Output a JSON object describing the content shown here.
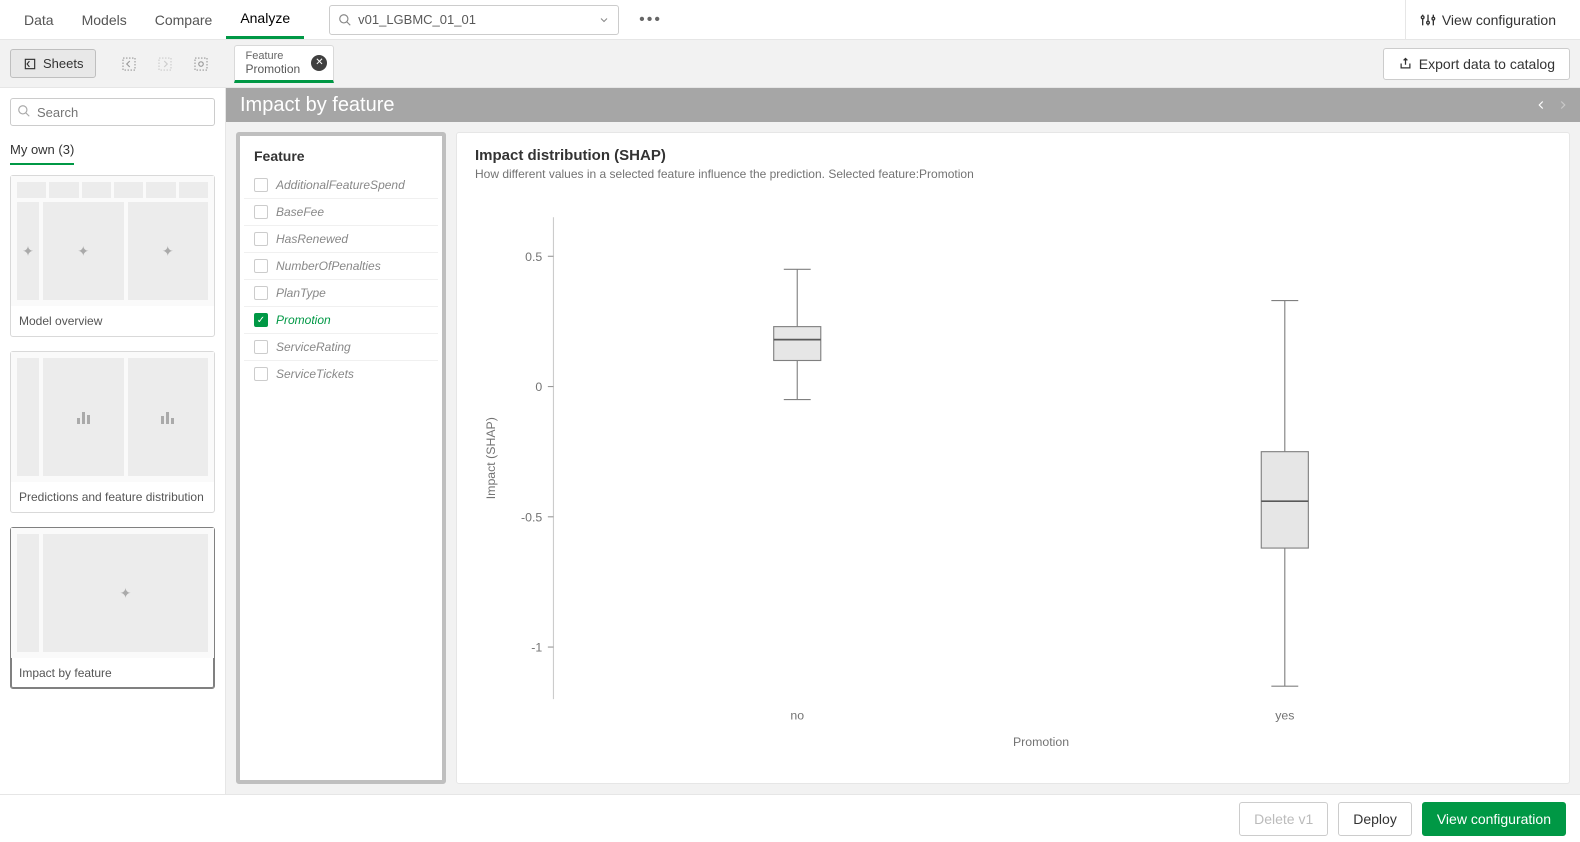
{
  "top_tabs": {
    "data": "Data",
    "models": "Models",
    "compare": "Compare",
    "analyze": "Analyze"
  },
  "search_value": "v01_LGBMC_01_01",
  "view_configuration": "View configuration",
  "sheets_btn": "Sheets",
  "feature_tab": {
    "label": "Feature",
    "value": "Promotion"
  },
  "export_label": "Export data to catalog",
  "sidebar": {
    "search_placeholder": "Search",
    "section": "My own (3)",
    "sheets": {
      "model_overview": "Model overview",
      "predictions": "Predictions and feature distribution",
      "impact": "Impact by feature"
    }
  },
  "main_title": "Impact by feature",
  "feature_panel_title": "Feature",
  "features": [
    {
      "name": "AdditionalFeatureSpend",
      "sel": false
    },
    {
      "name": "BaseFee",
      "sel": false
    },
    {
      "name": "HasRenewed",
      "sel": false
    },
    {
      "name": "NumberOfPenalties",
      "sel": false
    },
    {
      "name": "PlanType",
      "sel": false
    },
    {
      "name": "Promotion",
      "sel": true
    },
    {
      "name": "ServiceRating",
      "sel": false
    },
    {
      "name": "ServiceTickets",
      "sel": false
    }
  ],
  "chart_title": "Impact distribution (SHAP)",
  "chart_subtitle": "How different values in a selected feature influence the prediction. Selected feature:Promotion",
  "chart_xlabel": "Promotion",
  "chart_ylabel": "Impact (SHAP)",
  "chart_data": {
    "type": "boxplot",
    "title": "Impact distribution (SHAP)",
    "xlabel": "Promotion",
    "ylabel": "Impact (SHAP)",
    "ylim": [
      -1.2,
      0.65
    ],
    "yticks": [
      -1,
      -0.5,
      0,
      0.5
    ],
    "categories": [
      "no",
      "yes"
    ],
    "series": [
      {
        "category": "no",
        "min": -0.05,
        "q1": 0.1,
        "median": 0.18,
        "q3": 0.23,
        "max": 0.45
      },
      {
        "category": "yes",
        "min": -1.15,
        "q1": -0.62,
        "median": -0.44,
        "q3": -0.25,
        "max": 0.33
      }
    ]
  },
  "footer": {
    "delete": "Delete v1",
    "deploy": "Deploy",
    "view_conf": "View configuration"
  }
}
